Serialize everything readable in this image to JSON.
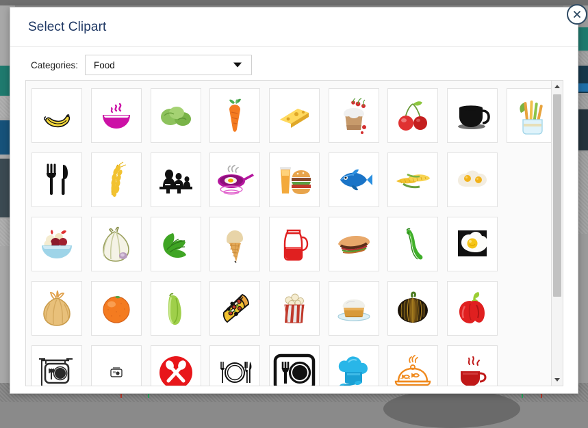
{
  "background": {
    "description": "web page behind modal overlay"
  },
  "dialog": {
    "title": "Select Clipart",
    "close_label": "Close",
    "close_icon": "close-circle-icon"
  },
  "categories": {
    "label": "Categories:",
    "selected": "Food",
    "caret_icon": "chevron-down-icon",
    "options": [
      "Food"
    ]
  },
  "scrollbar": {
    "up_icon": "chevron-up-icon",
    "down_icon": "chevron-down-icon"
  },
  "colors": {
    "title": "#1f3864",
    "panel_bg": "#fafafa",
    "tile_bg": "#ffffff",
    "tile_border": "#e2e2e2",
    "close_border": "#2e4a63"
  },
  "clipart": {
    "columns": 9,
    "items": [
      {
        "id": "banana",
        "name": "banana-clipart",
        "row": 1,
        "col": 1
      },
      {
        "id": "soup-bowl",
        "name": "soup-bowl-clipart",
        "row": 1,
        "col": 2
      },
      {
        "id": "brussels-sprouts",
        "name": "brussels-sprouts-clipart",
        "row": 1,
        "col": 3
      },
      {
        "id": "carrot",
        "name": "carrot-clipart",
        "row": 1,
        "col": 4
      },
      {
        "id": "cheese",
        "name": "cheese-wedge-clipart",
        "row": 1,
        "col": 5
      },
      {
        "id": "cupcake",
        "name": "cupcake-clipart",
        "row": 1,
        "col": 6
      },
      {
        "id": "cherries",
        "name": "cherries-clipart",
        "row": 1,
        "col": 7
      },
      {
        "id": "coffee-cup-black",
        "name": "black-coffee-cup-clipart",
        "row": 1,
        "col": 8
      },
      {
        "id": "veggie-sticks",
        "name": "veggie-sticks-glass-clipart",
        "row": 1,
        "col": 9
      },
      {
        "id": "fork-knife",
        "name": "fork-and-knife-clipart",
        "row": 2,
        "col": 1
      },
      {
        "id": "wheat",
        "name": "wheat-stalk-clipart",
        "row": 2,
        "col": 2
      },
      {
        "id": "family-dining",
        "name": "family-dining-clipart",
        "row": 2,
        "col": 3
      },
      {
        "id": "fried-egg-pan",
        "name": "frying-pan-egg-clipart",
        "row": 2,
        "col": 4
      },
      {
        "id": "burger-drink",
        "name": "burger-and-drink-clipart",
        "row": 2,
        "col": 5
      },
      {
        "id": "fish",
        "name": "fish-clipart",
        "row": 2,
        "col": 6
      },
      {
        "id": "corn",
        "name": "corn-cobs-clipart",
        "row": 2,
        "col": 7
      },
      {
        "id": "fried-eggs",
        "name": "fried-eggs-clipart",
        "row": 2,
        "col": 8
      },
      {
        "id": "",
        "name": "empty-cell",
        "row": 2,
        "col": 9,
        "empty": true
      },
      {
        "id": "fruit-salad",
        "name": "fruit-salad-bowl-clipart",
        "row": 3,
        "col": 1
      },
      {
        "id": "garlic",
        "name": "garlic-bulb-clipart",
        "row": 3,
        "col": 2
      },
      {
        "id": "lettuce",
        "name": "lettuce-leaf-clipart",
        "row": 3,
        "col": 3
      },
      {
        "id": "ice-cream",
        "name": "ice-cream-cone-clipart",
        "row": 3,
        "col": 4
      },
      {
        "id": "pitcher",
        "name": "red-pitcher-clipart",
        "row": 3,
        "col": 5
      },
      {
        "id": "sandwich",
        "name": "sandwich-clipart",
        "row": 3,
        "col": 6
      },
      {
        "id": "okra",
        "name": "okra-clipart",
        "row": 3,
        "col": 7
      },
      {
        "id": "egg-on-black",
        "name": "fried-egg-square-clipart",
        "row": 3,
        "col": 8
      },
      {
        "id": "",
        "name": "empty-cell",
        "row": 3,
        "col": 9,
        "empty": true
      },
      {
        "id": "onion",
        "name": "onion-clipart",
        "row": 4,
        "col": 1
      },
      {
        "id": "orange",
        "name": "orange-fruit-clipart",
        "row": 4,
        "col": 2
      },
      {
        "id": "cucumber",
        "name": "cucumber-clipart",
        "row": 4,
        "col": 3
      },
      {
        "id": "pizza",
        "name": "pizza-slice-clipart",
        "row": 4,
        "col": 4
      },
      {
        "id": "popcorn",
        "name": "popcorn-clipart",
        "row": 4,
        "col": 5
      },
      {
        "id": "pudding",
        "name": "pudding-plate-clipart",
        "row": 4,
        "col": 6
      },
      {
        "id": "pumpkin",
        "name": "pumpkin-clipart",
        "row": 4,
        "col": 7
      },
      {
        "id": "bell-pepper",
        "name": "red-bell-pepper-clipart",
        "row": 4,
        "col": 8
      },
      {
        "id": "",
        "name": "empty-cell",
        "row": 4,
        "col": 9,
        "empty": true
      },
      {
        "id": "restaurant-sign",
        "name": "restaurant-sign-clipart",
        "row": 5,
        "col": 1
      },
      {
        "id": "restaurant-small",
        "name": "small-restaurant-icon-clipart",
        "row": 5,
        "col": 2
      },
      {
        "id": "no-food-badge",
        "name": "crossed-utensils-badge-clipart",
        "row": 5,
        "col": 3
      },
      {
        "id": "place-setting",
        "name": "place-setting-clipart",
        "row": 5,
        "col": 4
      },
      {
        "id": "restaurant-bold",
        "name": "bold-restaurant-icon-clipart",
        "row": 5,
        "col": 5
      },
      {
        "id": "chef-hat",
        "name": "chef-hat-clipart",
        "row": 5,
        "col": 6
      },
      {
        "id": "food-dome",
        "name": "food-dome-clipart",
        "row": 5,
        "col": 7
      },
      {
        "id": "coffee-cup-red",
        "name": "red-coffee-cup-clipart",
        "row": 5,
        "col": 8
      },
      {
        "id": "",
        "name": "empty-cell",
        "row": 5,
        "col": 9,
        "empty": true
      }
    ]
  }
}
